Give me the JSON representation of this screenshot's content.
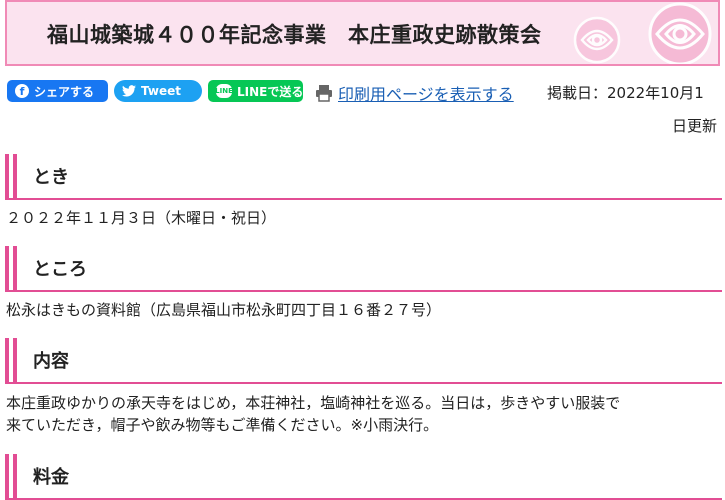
{
  "banner": {
    "title": "福山城築城４００年記念事業　本庄重政史跡散策会"
  },
  "share": {
    "facebook_label": "シェアする",
    "facebook_icon": "f",
    "twitter_label": "Tweet",
    "line_label": "LINEで送る",
    "line_icon": "LINE",
    "print_label": "印刷用ページを表示する",
    "date_prefix": "掲載日：2022年10月1",
    "date_suffix": "日更新"
  },
  "sections": [
    {
      "title": "とき",
      "body": "２０２２年１１月３日（木曜日・祝日）"
    },
    {
      "title": "ところ",
      "body": "松永はきもの資料館（広島県福山市松永町四丁目１６番２７号）"
    },
    {
      "title": "内容",
      "body_line1": "本庄重政ゆかりの承天寺をはじめ，本荘神社，塩崎神社を巡る。当日は，歩きやすい服装で",
      "body_line2": "来ていただき，帽子や飲み物等もご準備ください。※小雨決行。"
    },
    {
      "title": "料金"
    }
  ],
  "colors": {
    "accent": "#e24d94",
    "banner_bg": "#fbe3ef",
    "link": "#1a5fb4",
    "facebook": "#1877f2",
    "twitter": "#1da1f2",
    "line": "#06c755"
  }
}
